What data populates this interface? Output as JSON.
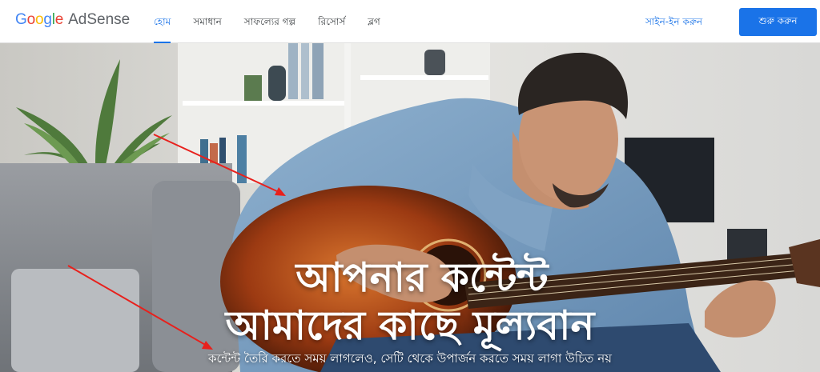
{
  "header": {
    "logo": {
      "google": "Google",
      "adsense": "AdSense"
    },
    "nav": [
      {
        "label": "হোম",
        "active": true
      },
      {
        "label": "সমাধান",
        "active": false
      },
      {
        "label": "সাফল্যের গল্প",
        "active": false
      },
      {
        "label": "রিসোর্স",
        "active": false
      },
      {
        "label": "ব্লগ",
        "active": false
      }
    ],
    "signin_label": "সাইন-ইন করুন",
    "cta_label": "শুরু করুন"
  },
  "hero": {
    "headline_line1": "আপনার কন্টেন্ট",
    "headline_line2": "আমাদের কাছে মূল্যবান",
    "subtext": "কন্টেন্ট তৈরি করতে সময় লাগলেও, সেটি থেকে উপার্জন করতে সময় লাগা উচিত নয়"
  },
  "colors": {
    "accent": "#1a73e8",
    "google_blue": "#4285f4",
    "google_red": "#ea4335",
    "google_yellow": "#fbbc05",
    "google_green": "#34a853",
    "annotation_arrow": "#e8201c"
  }
}
